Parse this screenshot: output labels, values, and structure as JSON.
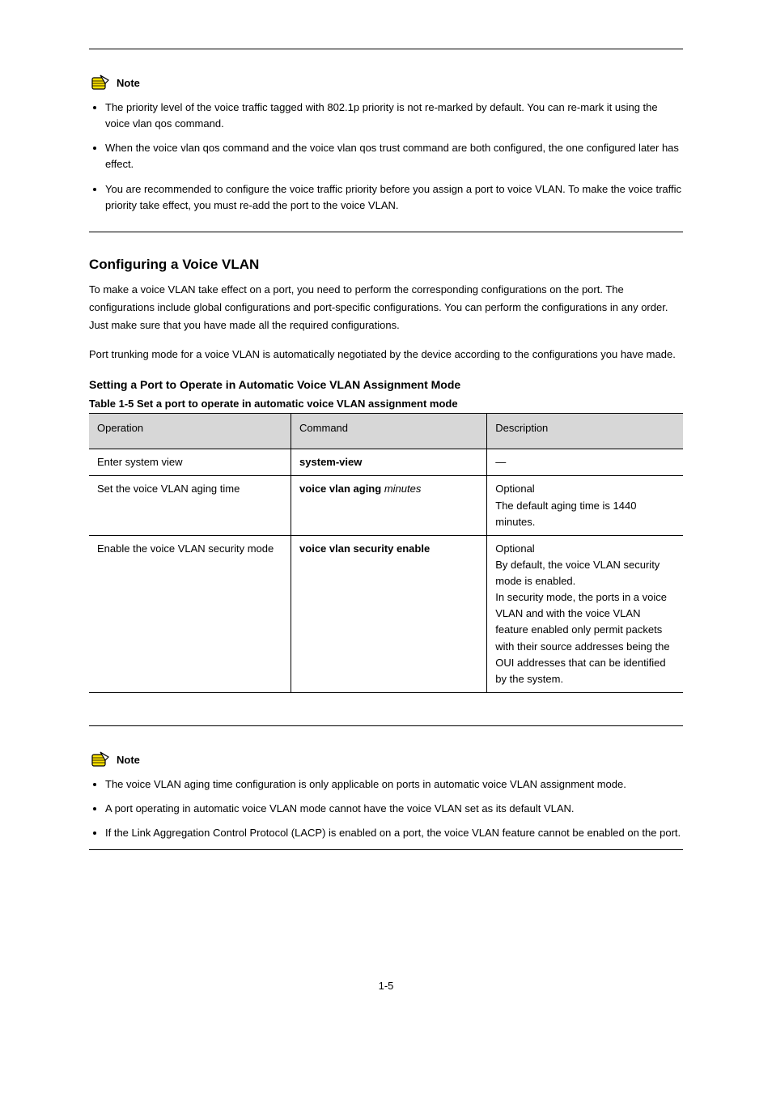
{
  "noteLabel": "Note",
  "note1": {
    "items": [
      "The priority level of the voice traffic tagged with 802.1p priority is not re-marked by default. You can re-mark it using the voice vlan qos command.",
      "When the voice vlan qos command and the voice vlan qos trust command are both configured, the one configured later has effect.",
      "You are recommended to configure the voice traffic priority before you assign a port to voice VLAN. To make the voice traffic priority take effect, you must re-add the port to the voice VLAN."
    ]
  },
  "section": {
    "title": "Configuring a Voice VLAN",
    "para1": "To make a voice VLAN take effect on a port, you need to perform the corresponding configurations on the port. The configurations include global configurations and port-specific configurations. You can perform the configurations in any order. Just make sure that you have made all the required configurations.",
    "para2": "Port trunking mode for a voice VLAN is automatically negotiated by the device according to the configurations you have made."
  },
  "sub": {
    "title": "Setting a Port to Operate in Automatic Voice VLAN Assignment Mode",
    "caption": "Table 1-5 Set a port to operate in automatic voice VLAN assignment mode"
  },
  "table": {
    "headers": [
      "Operation",
      "Command",
      "Description"
    ],
    "rows": [
      {
        "op": "Enter system view",
        "cmd": "system-view",
        "desc": "—",
        "cmd_bold": true
      },
      {
        "op": "Set the voice VLAN aging time",
        "cmd_pre": "voice vlan aging ",
        "cmd_arg": "minutes",
        "desc": "Optional\nThe default aging time is 1440 minutes."
      },
      {
        "op": "Enable the voice VLAN security mode",
        "cmd": "voice vlan security enable",
        "desc": "Optional\nBy default, the voice VLAN security mode is enabled.\nIn security mode, the ports in a voice VLAN and with the voice VLAN feature enabled only permit packets with their source addresses being the OUI addresses that can be identified by the system.",
        "cmd_bold": true
      }
    ]
  },
  "note2": {
    "items": [
      "The voice VLAN aging time configuration is only applicable on ports in automatic voice VLAN assignment mode.",
      "A port operating in automatic voice VLAN mode cannot have the voice VLAN set as its default VLAN.",
      "If the Link Aggregation Control Protocol (LACP) is enabled on a port, the voice VLAN feature cannot be enabled on the port."
    ]
  },
  "pageNumber": "1-5"
}
